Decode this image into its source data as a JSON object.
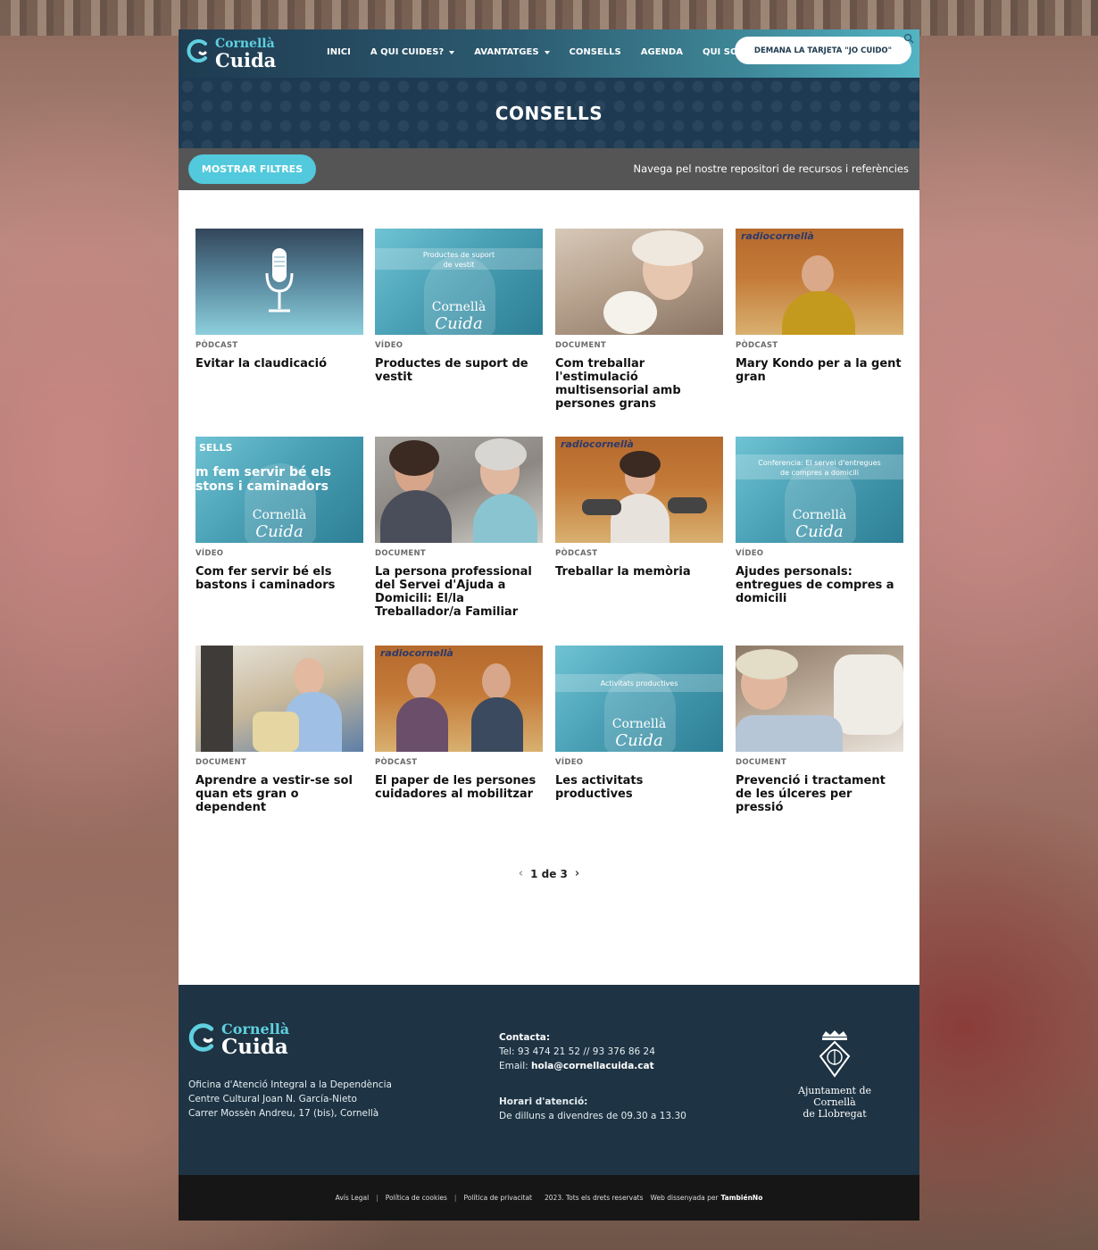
{
  "header": {
    "logo_top": "Cornellà",
    "logo_bottom": "Cuida",
    "nav": [
      {
        "label": "INICI",
        "dropdown": false
      },
      {
        "label": "A QUI CUIDES?",
        "dropdown": true
      },
      {
        "label": "AVANTATGES",
        "dropdown": true
      },
      {
        "label": "CONSELLS",
        "dropdown": false
      },
      {
        "label": "AGENDA",
        "dropdown": false
      },
      {
        "label": "QUI SOM",
        "dropdown": false
      }
    ],
    "cta_label": "DEMANA LA TARJETA \"JO CUIDO\""
  },
  "banner": {
    "title": "CONSELLS"
  },
  "filters": {
    "button_label": "MOSTRAR FILTRES",
    "tagline": "Navega pel nostre repositori de recursos i referències"
  },
  "cards": [
    {
      "type": "PÒDCAST",
      "title": "Evitar la claudicació"
    },
    {
      "type": "VÍDEO",
      "title": "Productes de suport de vestit",
      "thumb_caption": "Productes de suport de vestit"
    },
    {
      "type": "DOCUMENT",
      "title": "Com treballar l'estimulació multisensorial amb persones grans"
    },
    {
      "type": "PÒDCAST",
      "title": "Mary Kondo per a la gent gran",
      "thumb_caption": "radiocornellà"
    },
    {
      "type": "VÍDEO",
      "title": "Com fer servir bé els bastons i caminadors",
      "thumb_caption": "SELLS",
      "thumb_overlay": [
        "m fem servir bé els",
        "stons i caminadors"
      ]
    },
    {
      "type": "DOCUMENT",
      "title": "La persona professional del Servei d'Ajuda a Domicili: El/la Treballador/a Familiar"
    },
    {
      "type": "PÒDCAST",
      "title": "Treballar la memòria",
      "thumb_caption": "radiocornellà"
    },
    {
      "type": "VÍDEO",
      "title": "Ajudes personals: entregues de compres a domicili",
      "thumb_caption": "Conferencia: El servei d'entregues de compres a domicili"
    },
    {
      "type": "DOCUMENT",
      "title": "Aprendre a vestir-se sol quan ets gran o dependent"
    },
    {
      "type": "PÒDCAST",
      "title": "El paper de les persones cuidadores al mobilitzar",
      "thumb_caption": "radiocornellà"
    },
    {
      "type": "VÍDEO",
      "title": "Les activitats productives",
      "thumb_caption": "Activitats productives"
    },
    {
      "type": "DOCUMENT",
      "title": "Prevenció i tractament de les úlceres per pressió"
    }
  ],
  "thumb_brand": {
    "line1": "Cornellà",
    "line2": "Cuida"
  },
  "pager": {
    "label": "1 de 3"
  },
  "footer": {
    "address": [
      "Oficina d'Atenció Integral a la Dependència",
      "Centre Cultural Joan N. García-Nieto",
      "Carrer Mossèn Andreu, 17 (bis), Cornellà"
    ],
    "contact_heading": "Contacta:",
    "phone": "Tel: 93 474 21 52 // 93 376 86 24",
    "email_label": "Email:",
    "email": "hola@cornellacuida.cat",
    "hours_heading": "Horari d'atenció:",
    "hours": "De dilluns a divendres de 09.30 a 13.30",
    "council_line1": "Ajuntament de Cornellà",
    "council_line2": "de Llobregat"
  },
  "bottom": {
    "legal": "Avís Legal",
    "cookies": "Política de cookies",
    "privacy": "Política de privacitat",
    "rights": "2023. Tots els drets reservats",
    "credit": "Web dissenyada per",
    "credit_brand": "TambiénNo"
  },
  "colors": {
    "accent": "#52c9dc",
    "dark": "#1e3343",
    "banner": "#1d3a52"
  }
}
